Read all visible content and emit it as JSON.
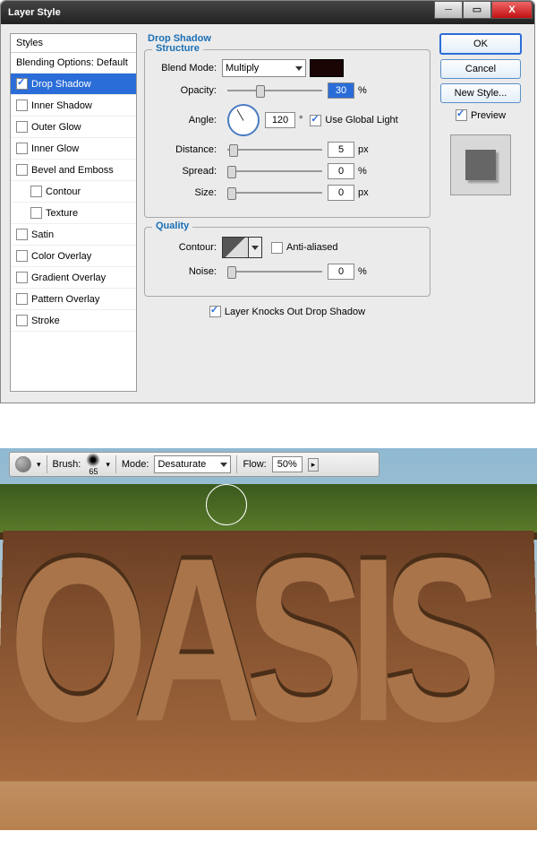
{
  "dialog": {
    "title": "Layer Style",
    "styles_header": "Styles",
    "styles": {
      "blending": "Blending Options: Default",
      "drop_shadow": "Drop Shadow",
      "inner_shadow": "Inner Shadow",
      "outer_glow": "Outer Glow",
      "inner_glow": "Inner Glow",
      "bevel": "Bevel and Emboss",
      "contour": "Contour",
      "texture": "Texture",
      "satin": "Satin",
      "color_overlay": "Color Overlay",
      "gradient_overlay": "Gradient Overlay",
      "pattern_overlay": "Pattern Overlay",
      "stroke": "Stroke"
    },
    "panel_title": "Drop Shadow",
    "structure": {
      "legend": "Structure",
      "blend_mode_label": "Blend Mode:",
      "blend_mode_value": "Multiply",
      "opacity_label": "Opacity:",
      "opacity_value": "30",
      "opacity_unit": "%",
      "angle_label": "Angle:",
      "angle_value": "120",
      "angle_unit": "°",
      "use_global": "Use Global Light",
      "distance_label": "Distance:",
      "distance_value": "5",
      "distance_unit": "px",
      "spread_label": "Spread:",
      "spread_value": "0",
      "spread_unit": "%",
      "size_label": "Size:",
      "size_value": "0",
      "size_unit": "px"
    },
    "quality": {
      "legend": "Quality",
      "contour_label": "Contour:",
      "anti_aliased": "Anti-aliased",
      "noise_label": "Noise:",
      "noise_value": "0",
      "noise_unit": "%"
    },
    "knockout": "Layer Knocks Out Drop Shadow",
    "buttons": {
      "ok": "OK",
      "cancel": "Cancel",
      "new_style": "New Style...",
      "preview": "Preview"
    }
  },
  "toolbar": {
    "brush_label": "Brush:",
    "brush_size": "65",
    "mode_label": "Mode:",
    "mode_value": "Desaturate",
    "flow_label": "Flow:",
    "flow_value": "50%"
  },
  "hero_text": "OASIS"
}
